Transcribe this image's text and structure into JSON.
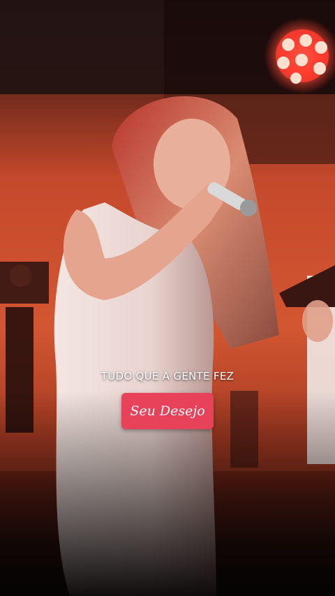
{
  "overlay": {
    "caption": "TUDO QUE A GENTE FEZ",
    "badge_label": "Seu Desejo",
    "badge_color": "#e8415a"
  },
  "scene": {
    "description_icons": [
      "stage-light-icon",
      "microphone-icon",
      "guitar-icon"
    ],
    "colors": {
      "stage_backdrop": "#c0462a",
      "stage_light": "#ff3b2f",
      "dress": "#e9e6e4",
      "hair": "#a8322b",
      "shadow": "#0d0707"
    }
  }
}
